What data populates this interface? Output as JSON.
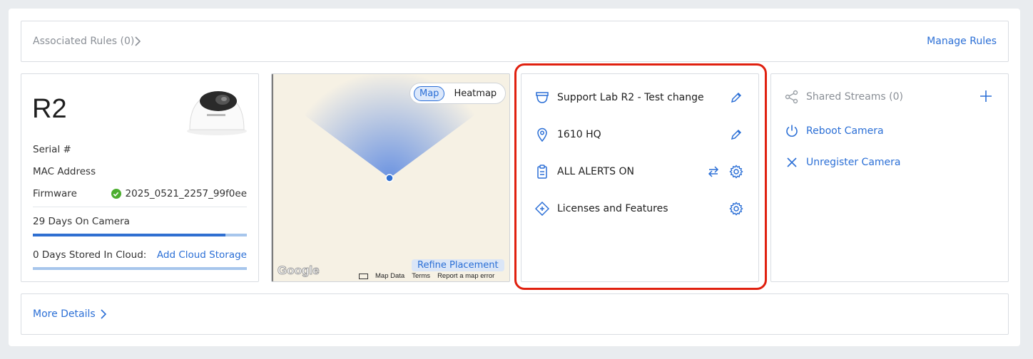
{
  "rules": {
    "label": "Associated Rules (0)",
    "manage_label": "Manage Rules"
  },
  "camera": {
    "name": "R2",
    "serial_label": "Serial #",
    "mac_label": "MAC Address",
    "firmware_label": "Firmware",
    "firmware_value": "2025_0521_2257_99f0ee",
    "days_on_camera": "29 Days On Camera",
    "days_on_camera_progress": 0.9,
    "days_in_cloud": "0 Days Stored In Cloud:",
    "add_cloud_label": "Add Cloud Storage"
  },
  "map": {
    "toggle": {
      "map_label": "Map",
      "heatmap_label": "Heatmap",
      "selected": "Map"
    },
    "refine_label": "Refine Placement",
    "google_logo": "Google",
    "footer": {
      "map_data": "Map Data",
      "terms": "Terms",
      "report": "Report a map error"
    }
  },
  "settings": {
    "rows": [
      {
        "label": "Support Lab R2 - Test change",
        "icon": "camera-dome-icon",
        "actions": [
          "edit-icon"
        ]
      },
      {
        "label": "1610 HQ",
        "icon": "location-pin-icon",
        "actions": [
          "edit-icon"
        ]
      },
      {
        "label": "ALL ALERTS ON",
        "icon": "clipboard-icon",
        "actions": [
          "swap-icon",
          "gear-icon"
        ]
      },
      {
        "label": "Licenses and Features",
        "icon": "diamond-plus-icon",
        "actions": [
          "gear-icon"
        ]
      }
    ]
  },
  "actions": {
    "shared_streams_label": "Shared Streams (0)",
    "reboot_label": "Reboot Camera",
    "unregister_label": "Unregister Camera"
  },
  "more": {
    "label": "More Details"
  },
  "colors": {
    "accent": "#2b6fd6",
    "highlight": "#e0200f",
    "success": "#4cae2f",
    "map_bg": "#f6f1e4"
  }
}
